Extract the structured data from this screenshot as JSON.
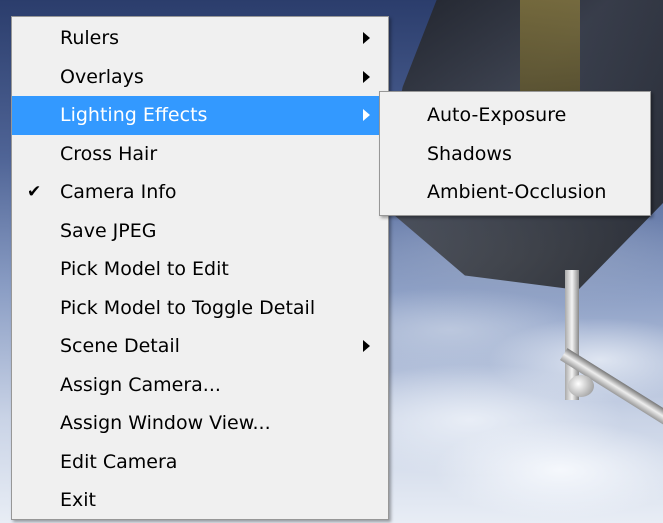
{
  "menu": {
    "items": [
      {
        "label": "Rulers",
        "has_submenu": true,
        "checked": false
      },
      {
        "label": "Overlays",
        "has_submenu": true,
        "checked": false
      },
      {
        "label": "Lighting Effects",
        "has_submenu": true,
        "checked": false,
        "highlighted": true
      },
      {
        "label": "Cross Hair",
        "has_submenu": false,
        "checked": false
      },
      {
        "label": "Camera Info",
        "has_submenu": false,
        "checked": true
      },
      {
        "label": "Save JPEG",
        "has_submenu": false,
        "checked": false
      },
      {
        "label": "Pick Model to Edit",
        "has_submenu": false,
        "checked": false
      },
      {
        "label": "Pick Model to Toggle Detail",
        "has_submenu": false,
        "checked": false
      },
      {
        "label": "Scene Detail",
        "has_submenu": true,
        "checked": false
      },
      {
        "label": "Assign Camera...",
        "has_submenu": false,
        "checked": false
      },
      {
        "label": "Assign Window View...",
        "has_submenu": false,
        "checked": false
      },
      {
        "label": "Edit Camera",
        "has_submenu": false,
        "checked": false
      },
      {
        "label": "Exit",
        "has_submenu": false,
        "checked": false
      }
    ],
    "check_glyph": "✔",
    "highlight_color": "#3399ff"
  },
  "submenu": {
    "items": [
      {
        "label": "Auto-Exposure"
      },
      {
        "label": "Shadows"
      },
      {
        "label": "Ambient-Occlusion"
      }
    ]
  }
}
